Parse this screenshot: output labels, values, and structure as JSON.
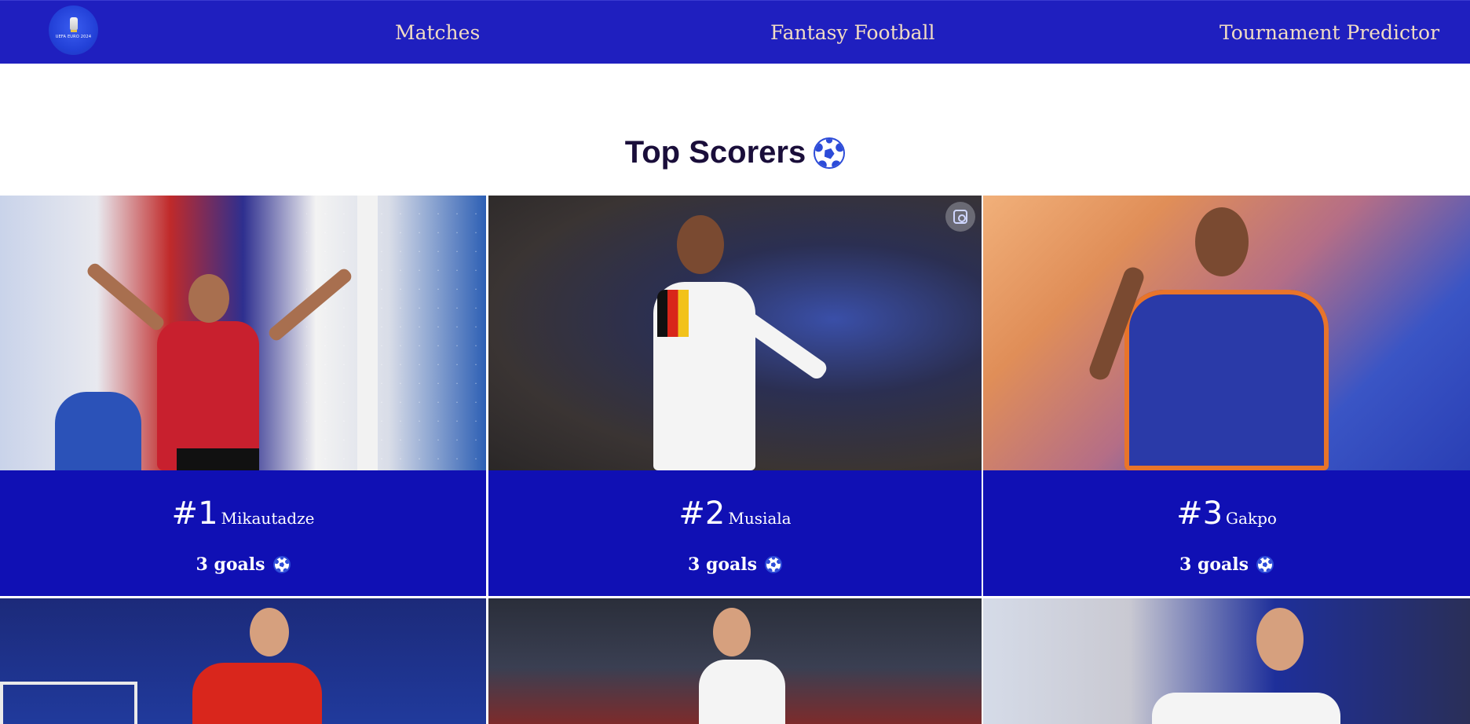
{
  "nav": {
    "logo_text": "UEFA EURO 2024",
    "links": [
      "Matches",
      "Fantasy Football",
      "Tournament Predictor"
    ]
  },
  "page": {
    "title": "Top Scorers",
    "title_icon": "soccer-ball-icon"
  },
  "scorers": [
    {
      "rank": "#1",
      "name": "Mikautadze",
      "goals": "3 goals",
      "icon": "soccer-ball-icon"
    },
    {
      "rank": "#2",
      "name": "Musiala",
      "goals": "3 goals",
      "icon": "soccer-ball-icon"
    },
    {
      "rank": "#3",
      "name": "Gakpo",
      "goals": "3 goals",
      "icon": "soccer-ball-icon"
    }
  ],
  "colors": {
    "navbar": "#1f1fbf",
    "card_info": "#1010b4",
    "nav_text": "#f1dcc3",
    "title_text": "#1a0e3a"
  }
}
